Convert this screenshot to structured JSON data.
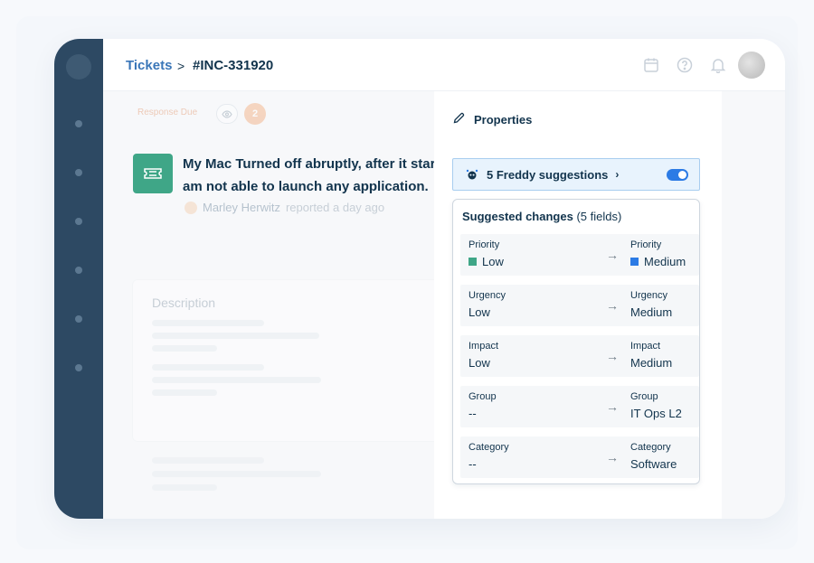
{
  "breadcrumb": {
    "parent": "Tickets",
    "separator": ">",
    "current": "#INC-331920"
  },
  "status": {
    "response_due": "Response Due",
    "watcher_count": "2"
  },
  "ticket": {
    "title": "My Mac Turned off abruptly, after it started I am not able to launch any application.",
    "reporter": "Marley Herwitz",
    "reported_text": "reported a day ago"
  },
  "description": {
    "title": "Description"
  },
  "properties": {
    "title": "Properties",
    "freddy": {
      "label": "5 Freddy suggestions",
      "chevron": "›",
      "toggle_on": true
    },
    "suggested": {
      "title": "Suggested changes",
      "count_text": "(5 fields)",
      "rows": [
        {
          "from_label": "Priority",
          "from_value": "Low",
          "from_color": "#3fa687",
          "to_label": "Priority",
          "to_value": "Medium",
          "to_color": "#2c7be5"
        },
        {
          "from_label": "Urgency",
          "from_value": "Low",
          "to_label": "Urgency",
          "to_value": "Medium"
        },
        {
          "from_label": "Impact",
          "from_value": "Low",
          "to_label": "Impact",
          "to_value": "Medium"
        },
        {
          "from_label": "Group",
          "from_value": "--",
          "to_label": "Group",
          "to_value": "IT Ops L2"
        },
        {
          "from_label": "Category",
          "from_value": "--",
          "to_label": "Category",
          "to_value": "Software"
        }
      ]
    }
  },
  "icons": [
    "calendar-icon",
    "help-icon",
    "bell-icon",
    "pencil-icon",
    "bot-icon",
    "ticket-icon",
    "eye-icon",
    "arrow-right-icon"
  ]
}
